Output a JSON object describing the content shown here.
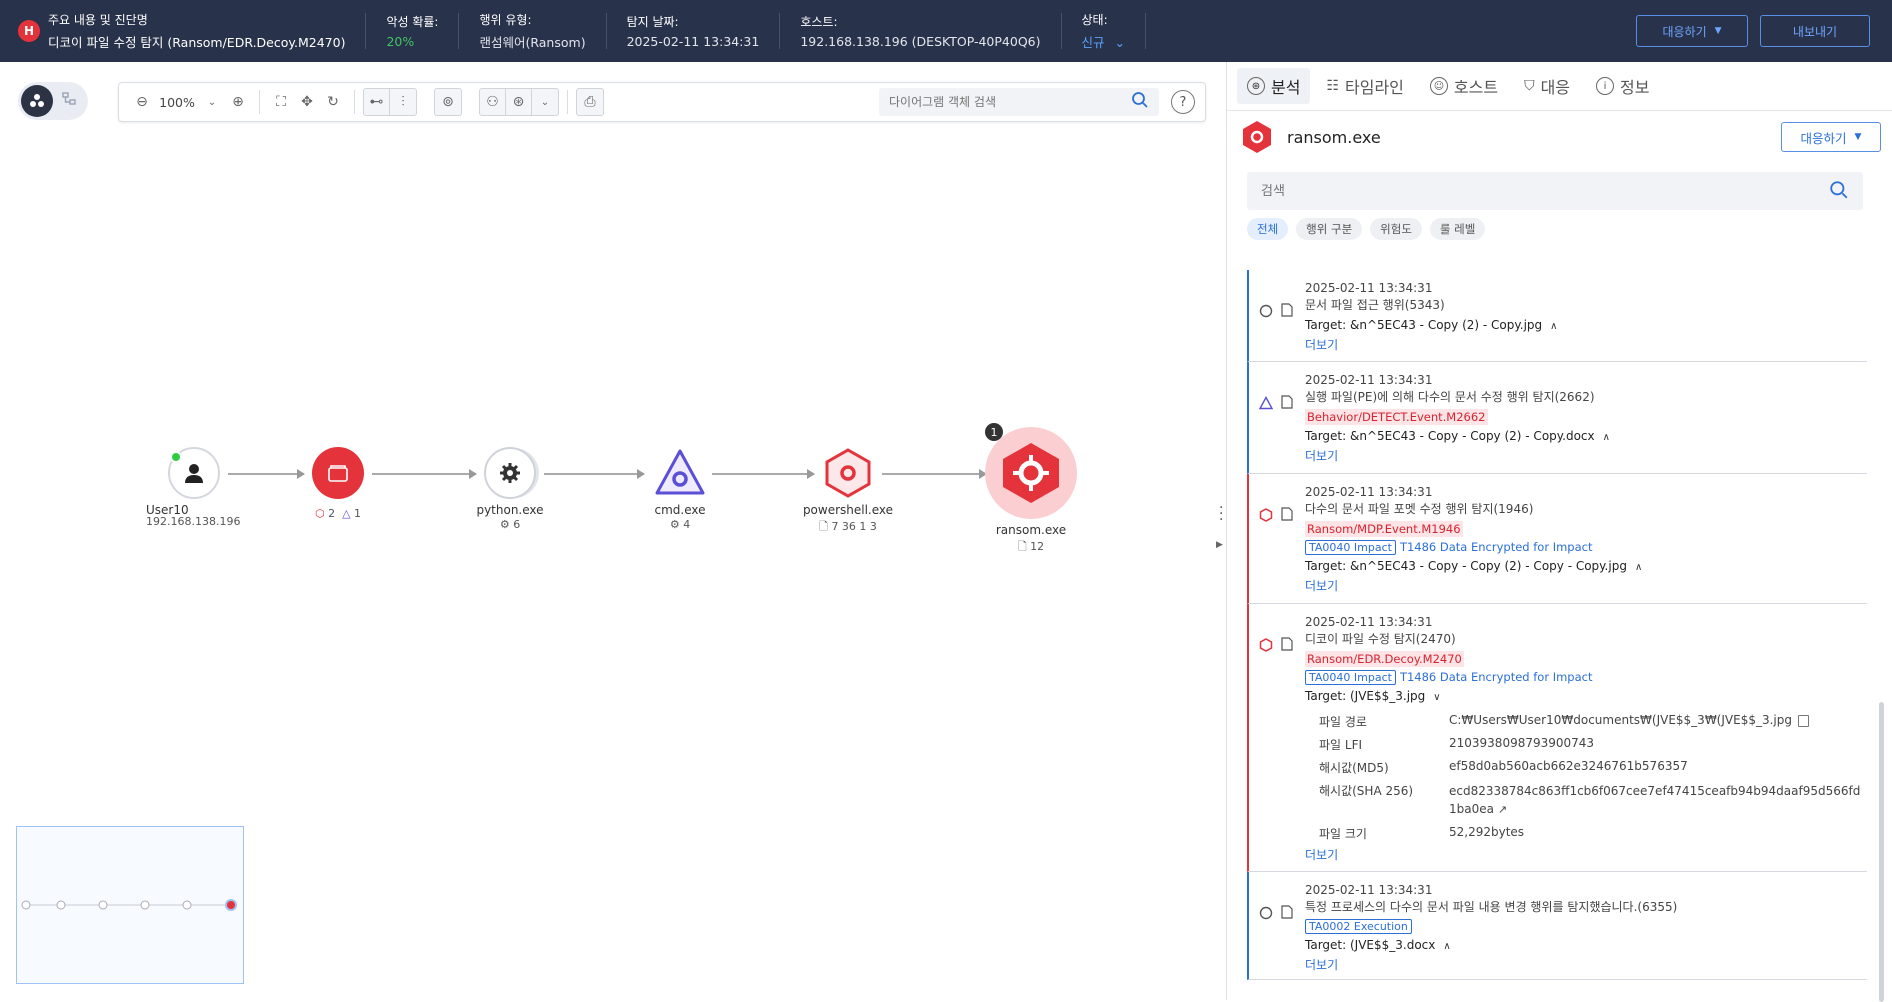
{
  "header": {
    "badge": "H",
    "cols": [
      {
        "label": "주요 내용 및 진단명",
        "value": "디코이 파일 수정 탐지 (Ransom/EDR.Decoy.M2470)"
      },
      {
        "label": "악성 확률:",
        "value": "20%"
      },
      {
        "label": "행위 유형:",
        "value": "랜섬웨어(Ransom)"
      },
      {
        "label": "탐지 날짜:",
        "value": "2025-02-11 13:34:31"
      },
      {
        "label": "호스트:",
        "value": "192.168.138.196 (DESKTOP-40P40Q6)"
      },
      {
        "label": "상태:",
        "value": "신규"
      }
    ],
    "respond_btn": "대응하기",
    "export_btn": "내보내기"
  },
  "toolbar": {
    "zoom": "100%",
    "search_placeholder": "다이어그램 객체 검색",
    "help": "?"
  },
  "graph": {
    "nodes": [
      {
        "name": "User10",
        "sub": "192.168.138.196"
      },
      {
        "name": "",
        "sub_hex": "2",
        "sub_tri": "1"
      },
      {
        "name": "python.exe",
        "sub": "6"
      },
      {
        "name": "cmd.exe",
        "sub": "4"
      },
      {
        "name": "powershell.exe",
        "sub": "7  36  1  3"
      },
      {
        "name": "ransom.exe",
        "sub": "12",
        "count": "1"
      }
    ]
  },
  "panel": {
    "tabs": [
      "분석",
      "타임라인",
      "호스트",
      "대응",
      "정보"
    ],
    "process": "ransom.exe",
    "respond_btn": "대응하기",
    "search_placeholder": "검색",
    "chips": [
      "전체",
      "행위 구분",
      "위험도",
      "룰 레벨"
    ],
    "more": "더보기",
    "items": [
      {
        "ts": "2025-02-11 13:34:31",
        "title": "문서 파일 접근 행위(5343)",
        "target": "Target: &n^5EC43 - Copy (2) - Copy.jpg"
      },
      {
        "ts": "2025-02-11 13:34:31",
        "title": "실행 파일(PE)에 의해 다수의 문서 수정 행위 탐지(2662)",
        "tag": "Behavior/DETECT.Event.M2662",
        "target": "Target: &n^5EC43 - Copy - Copy (2) - Copy.docx"
      },
      {
        "ts": "2025-02-11 13:34:31",
        "title": "다수의 문서 파일 포멧 수정 행위 탐지(1946)",
        "tag": "Ransom/MDP.Event.M1946",
        "tactic": "TA0040 Impact",
        "technique": "T1486 Data Encrypted for Impact",
        "target": "Target: &n^5EC43 - Copy - Copy (2) - Copy - Copy.jpg"
      },
      {
        "ts": "2025-02-11 13:34:31",
        "title": "디코이 파일 수정 탐지(2470)",
        "tag": "Ransom/EDR.Decoy.M2470",
        "tactic": "TA0040 Impact",
        "technique": "T1486 Data Encrypted for Impact",
        "target": "Target: (JVE$$_3.jpg",
        "details": [
          {
            "k": "파일 경로",
            "v": "C:₩Users₩User10₩documents₩(JVE$$_3₩(JVE$$_3.jpg"
          },
          {
            "k": "파일 LFI",
            "v": "2103938098793900743"
          },
          {
            "k": "해시값(MD5)",
            "v": "ef58d0ab560acb662e3246761b576357"
          },
          {
            "k": "해시값(SHA 256)",
            "v": "ecd82338784c863ff1cb6f067cee7ef47415ceafb94b94daaf95d566fd1ba0ea"
          },
          {
            "k": "파일 크기",
            "v": "52,292bytes"
          }
        ]
      },
      {
        "ts": "2025-02-11 13:34:31",
        "title": "특정 프로세스의 다수의 문서 파일 내용 변경 행위를 탐지했습니다.(6355)",
        "tactic": "TA0002 Execution",
        "target": "Target: (JVE$$_3.docx"
      }
    ]
  }
}
